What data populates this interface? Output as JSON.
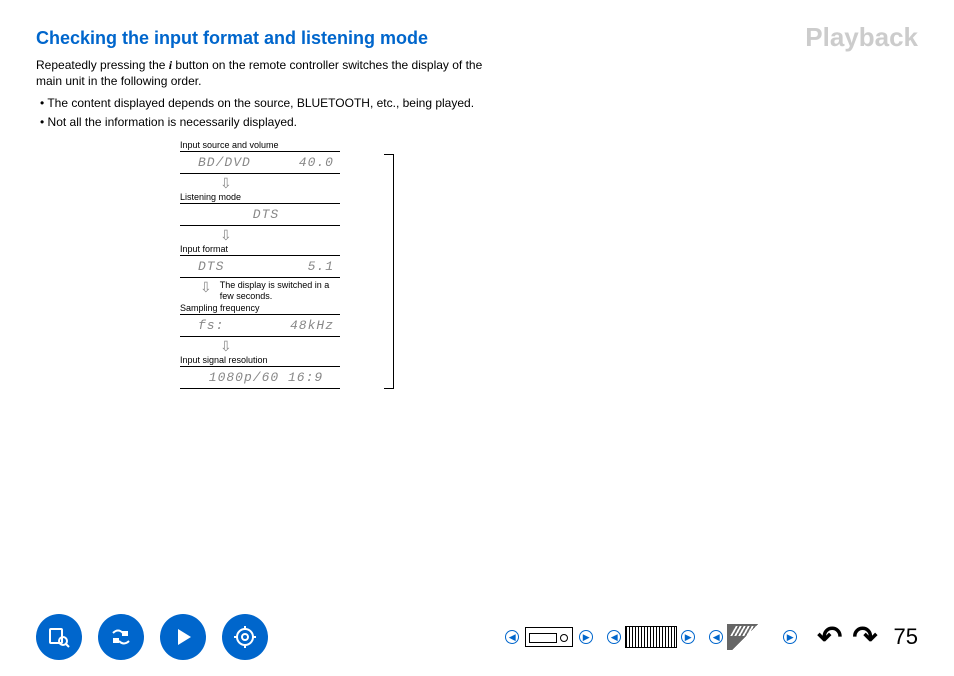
{
  "watermark": "Playback",
  "title": "Checking the input format and listening mode",
  "intro_before": "Repeatedly pressing the ",
  "intro_glyph": "i",
  "intro_after": " button on the remote controller switches the display of the main unit in the following order.",
  "bullets": [
    "The content displayed depends on the source, BLUETOOTH, etc., being played.",
    "Not all the information is necessarily displayed."
  ],
  "diagram": {
    "labels": {
      "source": "Input source and volume",
      "mode": "Listening mode",
      "format": "Input format",
      "freq": "Sampling frequency",
      "res": "Input signal resolution"
    },
    "note": "The display is switched in a few seconds.",
    "rows": {
      "r1a": "BD/DVD",
      "r1b": "40.0",
      "r2a": "DTS",
      "r3a": "DTS",
      "r3b": "5.1",
      "r4a": "fs:",
      "r4b": "48kHz",
      "r5a": "1080p/60 16:9"
    }
  },
  "page_number": "75"
}
